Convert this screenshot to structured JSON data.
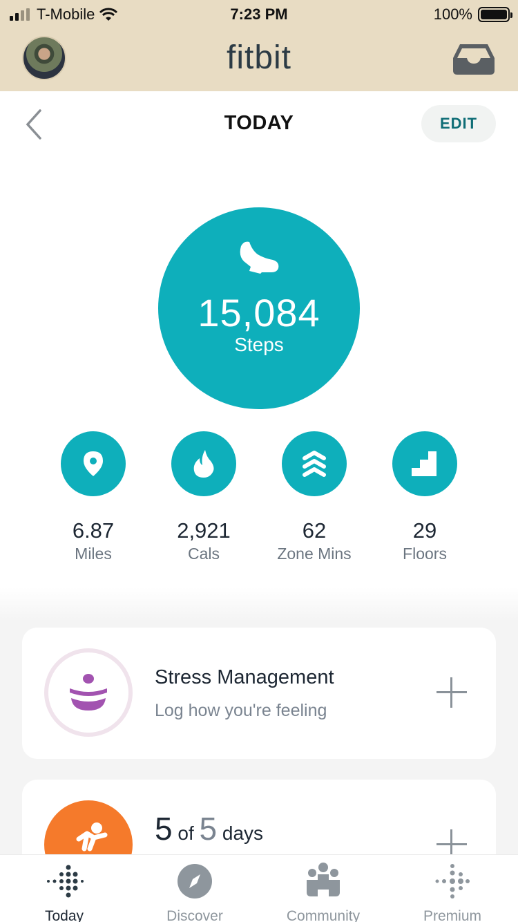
{
  "status_bar": {
    "carrier": "T-Mobile",
    "time": "7:23 PM",
    "battery": "100%"
  },
  "header": {
    "logo": "fitbit",
    "avatar_icon": "user-avatar",
    "inbox_icon": "inbox-icon"
  },
  "title_bar": {
    "back_icon": "chevron-left-icon",
    "title": "TODAY",
    "edit_label": "EDIT"
  },
  "steps": {
    "icon": "shoe-icon",
    "value": "15,084",
    "label": "Steps"
  },
  "stats": [
    {
      "icon": "location-pin-icon",
      "value": "6.87",
      "label": "Miles"
    },
    {
      "icon": "flame-icon",
      "value": "2,921",
      "label": "Cals"
    },
    {
      "icon": "zone-chevrons-icon",
      "value": "62",
      "label": "Zone Mins"
    },
    {
      "icon": "stairs-icon",
      "value": "29",
      "label": "Floors"
    }
  ],
  "cards": {
    "stress": {
      "icon": "stress-meditation-icon",
      "title": "Stress Management",
      "subtitle": "Log how you're feeling"
    },
    "exercise": {
      "icon": "running-person-icon",
      "count": "5",
      "of": "of",
      "total": "5",
      "unit": "days"
    }
  },
  "bottom_nav": [
    {
      "label": "Today",
      "icon": "fitbit-dots-icon",
      "active": true
    },
    {
      "label": "Discover",
      "icon": "compass-icon",
      "active": false
    },
    {
      "label": "Community",
      "icon": "community-people-icon",
      "active": false
    },
    {
      "label": "Premium",
      "icon": "premium-dots-icon",
      "active": false
    }
  ],
  "colors": {
    "header_bg": "#e8dcc3",
    "accent_teal": "#0eafbb",
    "edit_text": "#0f6d76",
    "stress_purple": "#a253b0",
    "exercise_orange": "#f57a2b"
  }
}
